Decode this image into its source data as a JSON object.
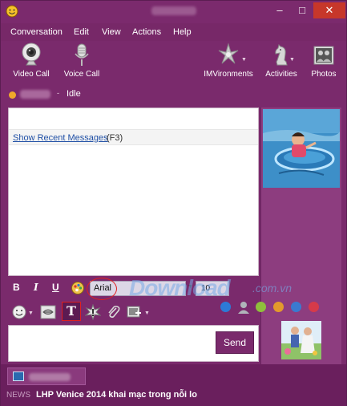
{
  "window": {
    "title_obscured": true,
    "controls": {
      "minimize": "–",
      "maximize": "□",
      "close": "✕"
    }
  },
  "menu": [
    "Conversation",
    "Edit",
    "View",
    "Actions",
    "Help"
  ],
  "toolbar": {
    "video_call": "Video Call",
    "voice_call": "Voice Call",
    "imvironments": "IMVironments",
    "activities": "Activities",
    "photos": "Photos"
  },
  "status": {
    "text": "Idle",
    "dash": "-"
  },
  "messages": {
    "recent_link": "Show Recent Messages",
    "recent_key": "(F3)"
  },
  "format": {
    "bold": "B",
    "italic": "I",
    "underline": "U",
    "font": "Arial",
    "size": "10"
  },
  "text_tool": "T",
  "input": {
    "send": "Send"
  },
  "watermark": {
    "main": "Download",
    "sub": ".com.vn"
  },
  "news": {
    "label": "NEWS",
    "headline": "LHP Venice 2014 khai mạc trong nỗi lo"
  },
  "colors": {
    "chrome": "#7a2a6c",
    "close_button": "#c7372a",
    "dots": [
      "#2d7ad6",
      "#b0b4ba",
      "#8fbf3c",
      "#e39a2c",
      "#3a7ad0",
      "#d63a4a"
    ]
  }
}
